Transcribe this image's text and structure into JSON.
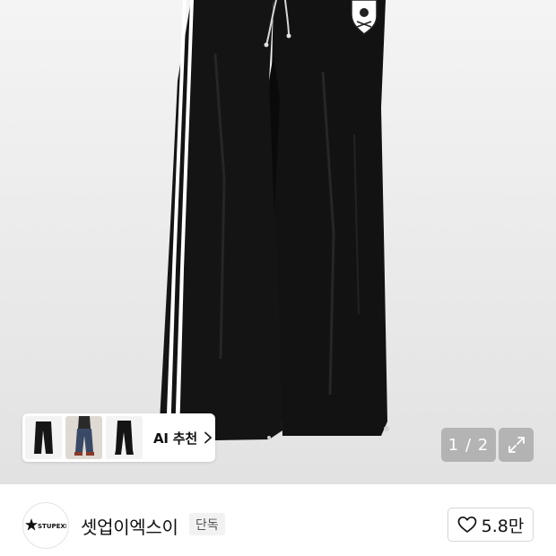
{
  "hero": {
    "image_subject": "black track pants with white side stripes",
    "pagination": "1 / 2",
    "expand_icon": "expand-arrows-icon"
  },
  "ai_recommend": {
    "label": "AI 추천",
    "chevron_icon": "chevron-right-icon",
    "thumbnails": [
      {
        "name": "thumb-black-pants"
      },
      {
        "name": "thumb-model-jeans"
      },
      {
        "name": "thumb-black-jogger"
      }
    ]
  },
  "brand": {
    "logo_text": "STUPEXE",
    "name": "셋업이엑스이",
    "tag": "단독"
  },
  "like": {
    "icon": "heart-icon",
    "count": "5.8만"
  }
}
